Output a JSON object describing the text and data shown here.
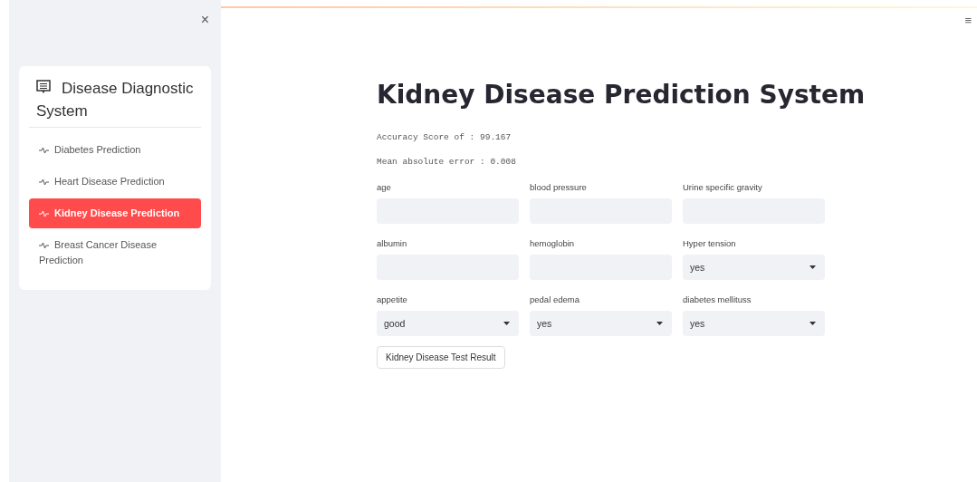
{
  "sidebar": {
    "close": "×",
    "title": "Disease Diagnostic System",
    "items": [
      {
        "label": "Diabetes Prediction",
        "selected": false
      },
      {
        "label": "Heart Disease Prediction",
        "selected": false
      },
      {
        "label": "Kidney Disease Prediction",
        "selected": true
      },
      {
        "label": "Breast Cancer Disease Prediction",
        "selected": false
      }
    ]
  },
  "main": {
    "menu": "≡",
    "title": "Kidney Disease Prediction System",
    "metrics": [
      "Accuracy Score of : 99.167",
      "Mean absolute error : 0.008"
    ],
    "fields": [
      {
        "label": "age",
        "kind": "text"
      },
      {
        "label": "blood pressure",
        "kind": "text"
      },
      {
        "label": "Urine specific gravity",
        "kind": "text"
      },
      {
        "label": "albumin",
        "kind": "text"
      },
      {
        "label": "hemoglobin",
        "kind": "text"
      },
      {
        "label": "Hyper tension",
        "kind": "select",
        "value": "yes"
      },
      {
        "label": "appetite",
        "kind": "select",
        "value": "good"
      },
      {
        "label": "pedal edema",
        "kind": "select",
        "value": "yes"
      },
      {
        "label": "diabetes mellituss",
        "kind": "select",
        "value": "yes"
      }
    ],
    "button": "Kidney Disease Test Result"
  }
}
